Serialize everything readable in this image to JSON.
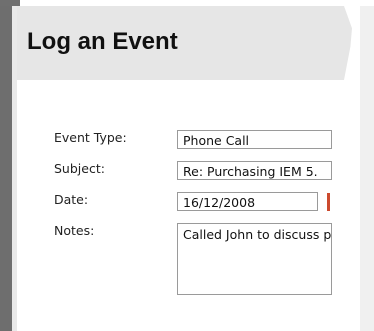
{
  "dialog": {
    "title": "Log an Event"
  },
  "form": {
    "event_type": {
      "label": "Event Type:",
      "value": "Phone Call"
    },
    "subject": {
      "label": "Subject:",
      "value": "Re: Purchasing IEM 5."
    },
    "date": {
      "label": "Date:",
      "value": "16/12/2008"
    },
    "notes": {
      "label": "Notes:",
      "value": "Called John to discuss p"
    }
  },
  "icons": {
    "date_picker": "calendar-icon"
  },
  "colors": {
    "header_bg": "#e6e6e6",
    "frame": "#6e6e6e",
    "date_icon": "#cc4a2e"
  }
}
